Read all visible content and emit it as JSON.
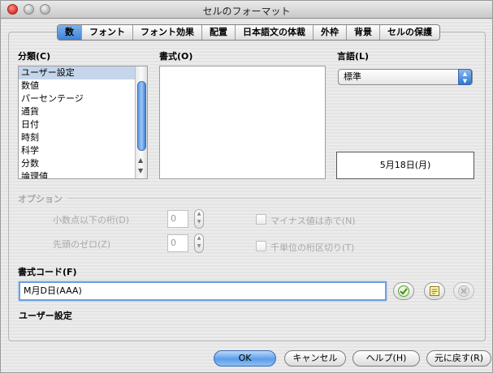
{
  "window": {
    "title": "セルのフォーマット"
  },
  "tabs": [
    {
      "label": "数",
      "active": true
    },
    {
      "label": "フォント",
      "active": false
    },
    {
      "label": "フォント効果",
      "active": false
    },
    {
      "label": "配置",
      "active": false
    },
    {
      "label": "日本語文の体裁",
      "active": false
    },
    {
      "label": "外枠",
      "active": false
    },
    {
      "label": "背景",
      "active": false
    },
    {
      "label": "セルの保護",
      "active": false
    }
  ],
  "category": {
    "label": "分類(C)",
    "items": [
      "ユーザー設定",
      "数値",
      "パーセンテージ",
      "通貨",
      "日付",
      "時刻",
      "科学",
      "分数",
      "論理値"
    ],
    "selected_index": 0
  },
  "format": {
    "label": "書式(O)"
  },
  "language": {
    "label": "言語(L)",
    "value": "標準"
  },
  "preview": {
    "text": "5月18日(月)"
  },
  "options": {
    "label": "オプション",
    "decimal_places_label": "小数点以下の桁(D)",
    "decimal_places_value": "0",
    "leading_zeros_label": "先頭のゼロ(Z)",
    "leading_zeros_value": "0",
    "negative_red_label": "マイナス値は赤で(N)",
    "thousands_sep_label": "千単位の桁区切り(T)"
  },
  "format_code": {
    "label": "書式コード(F)",
    "value": "M月D日(AAA)"
  },
  "format_description": "ユーザー設定",
  "buttons": {
    "ok": "OK",
    "cancel": "キャンセル",
    "help": "ヘルプ(H)",
    "reset": "元に戻す(R)"
  },
  "icons": {
    "accept": "checkmark-icon",
    "edit_comment": "note-edit-icon",
    "delete": "delete-x-icon"
  }
}
